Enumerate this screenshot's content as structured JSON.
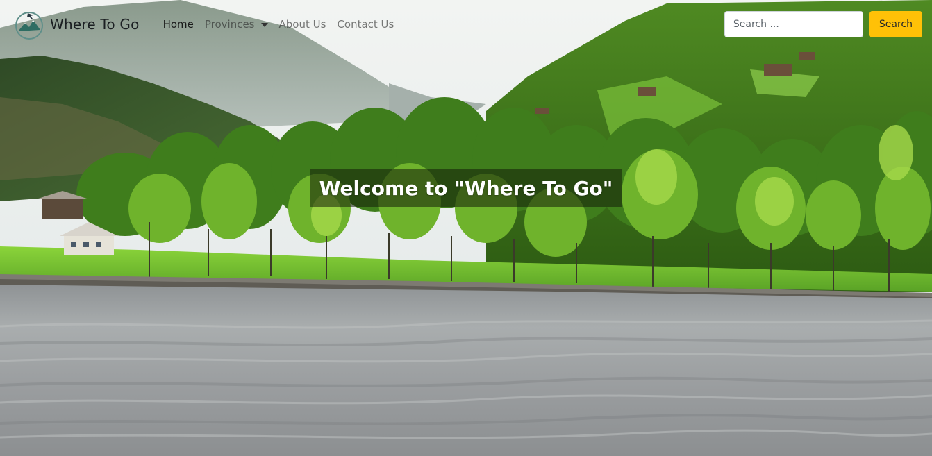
{
  "navbar": {
    "brand_name": "Where To Go",
    "links": [
      {
        "label": "Home",
        "active": true
      },
      {
        "label": "Provinces",
        "dropdown": true
      },
      {
        "label": "About Us"
      },
      {
        "label": "Contact Us"
      }
    ],
    "search": {
      "placeholder": "Search ...",
      "button_label": "Search"
    }
  },
  "hero": {
    "welcome_text": "Welcome to \"Where To Go\""
  },
  "colors": {
    "accent": "#ffc107",
    "text_dark": "#212529"
  },
  "icons": {
    "brand": "mountain-airplane-logo-icon",
    "dropdown": "caret-down-icon"
  }
}
